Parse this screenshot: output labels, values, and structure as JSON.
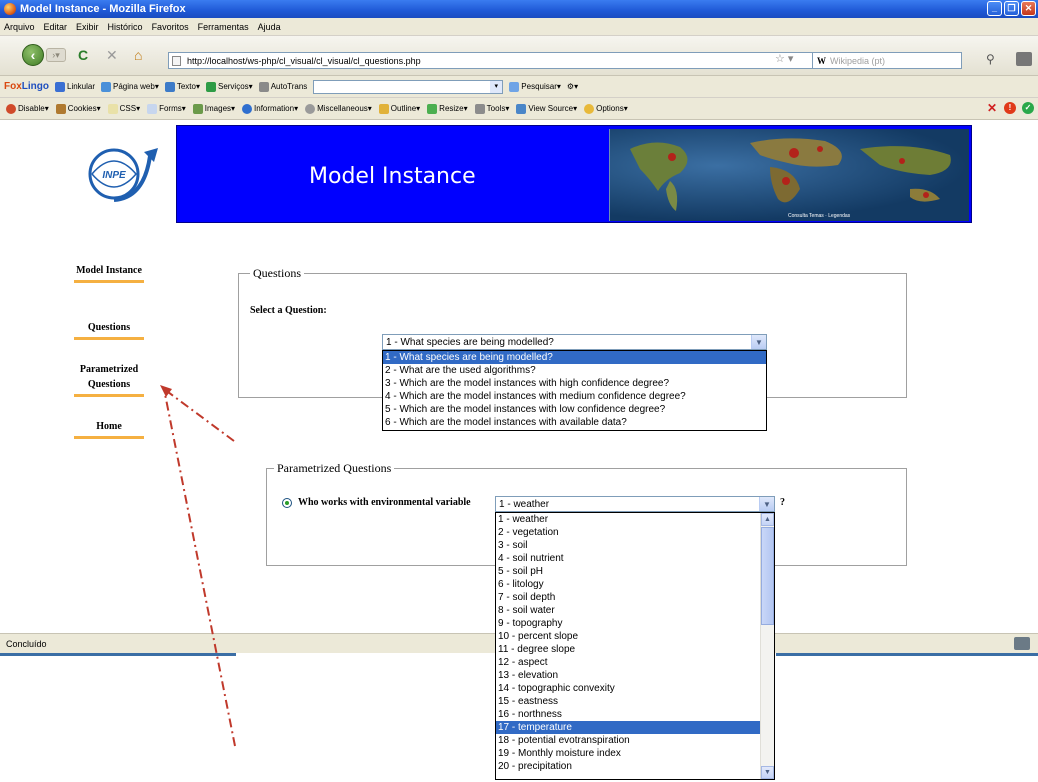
{
  "window": {
    "title": "Model Instance - Mozilla Firefox"
  },
  "menu": [
    "Arquivo",
    "Editar",
    "Exibir",
    "Histórico",
    "Favoritos",
    "Ferramentas",
    "Ajuda"
  ],
  "nav": {
    "url": "http://localhost/ws-php/cl_visual/cl_visual/cl_questions.php",
    "search_engine": "W",
    "search_placeholder": "Wikipedia (pt)"
  },
  "toolbar1": {
    "brand_a": "Fox",
    "brand_b": "Lingo",
    "items": [
      "Linkular",
      "Página web",
      "Texto",
      "Serviços",
      "AutoTrans"
    ],
    "search_label": "Pesquisar"
  },
  "toolbar2": {
    "items": [
      "Disable",
      "Cookies",
      "CSS",
      "Forms",
      "Images",
      "Information",
      "Miscellaneous",
      "Outline",
      "Resize",
      "Tools",
      "View Source",
      "Options"
    ]
  },
  "page": {
    "logo_text": "INPE",
    "banner_title": "Model Instance",
    "map_caption": "Consulta Temas · Legendas"
  },
  "sidebar": {
    "items": [
      {
        "label": "Model Instance"
      },
      {
        "label": "Questions"
      },
      {
        "label": "Parametrized Questions"
      },
      {
        "label": "Home"
      }
    ]
  },
  "questions": {
    "legend": "Questions",
    "prompt": "Select a Question:",
    "selected": "1 - What species are being modelled?",
    "options": [
      "1 - What species are being modelled?",
      "2 - What are the used algorithms?",
      "3 - Which are the model instances with high confidence degree?",
      "4 - Which are the model instances with medium confidence degree?",
      "5 - Which are the model instances with low confidence degree?",
      "6 - Which are the model instances with available data?"
    ]
  },
  "parametrized": {
    "legend": "Parametrized Questions",
    "radio_label": "Who works with environmental variable",
    "selected": "1 - weather",
    "suffix": "?",
    "options": [
      "1 - weather",
      "2 - vegetation",
      "3 - soil",
      "4 - soil nutrient",
      "5 - soil pH",
      "6 - litology",
      "7 - soil depth",
      "8 - soil water",
      "9 - topography",
      "10 - percent slope",
      "11 - degree slope",
      "12 - aspect",
      "13 - elevation",
      "14 - topographic convexity",
      "15 - eastness",
      "16 - northness",
      "17 - temperature",
      "18 - potential evotranspiration",
      "19 - Monthly moisture index",
      "20 - precipitation"
    ],
    "highlighted_index": 16
  },
  "status": {
    "text": "Concluído"
  },
  "colors": {
    "banner": "#0000ff",
    "nav_underline": "#f5b041",
    "highlight": "#316ac5",
    "arrow": "#c0392b"
  }
}
